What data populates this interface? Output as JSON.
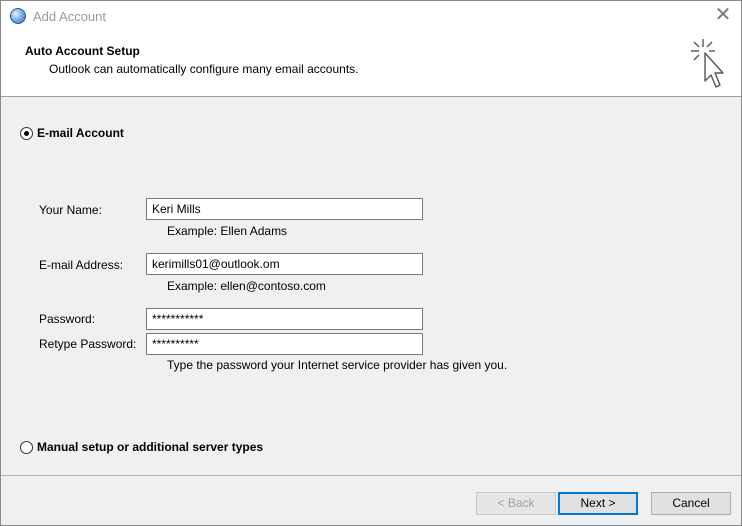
{
  "window": {
    "title": "Add Account"
  },
  "header": {
    "title": "Auto Account Setup",
    "subtitle": "Outlook can automatically configure many email accounts."
  },
  "options": {
    "email_account": {
      "label": "E-mail Account",
      "selected": true
    },
    "manual_setup": {
      "label": "Manual setup or additional server types",
      "selected": false
    }
  },
  "form": {
    "name": {
      "label": "Your Name:",
      "value": "Keri Mills",
      "example": "Example: Ellen Adams"
    },
    "email": {
      "label": "E-mail Address:",
      "value": "kerimills01@outlook.om",
      "example": "Example: ellen@contoso.com"
    },
    "password": {
      "label": "Password:",
      "value": "***********"
    },
    "retype_password": {
      "label": "Retype Password:",
      "value": "**********"
    },
    "password_hint": "Type the password your Internet service provider has given you."
  },
  "buttons": {
    "back": "< Back",
    "next": "Next >",
    "cancel": "Cancel"
  }
}
